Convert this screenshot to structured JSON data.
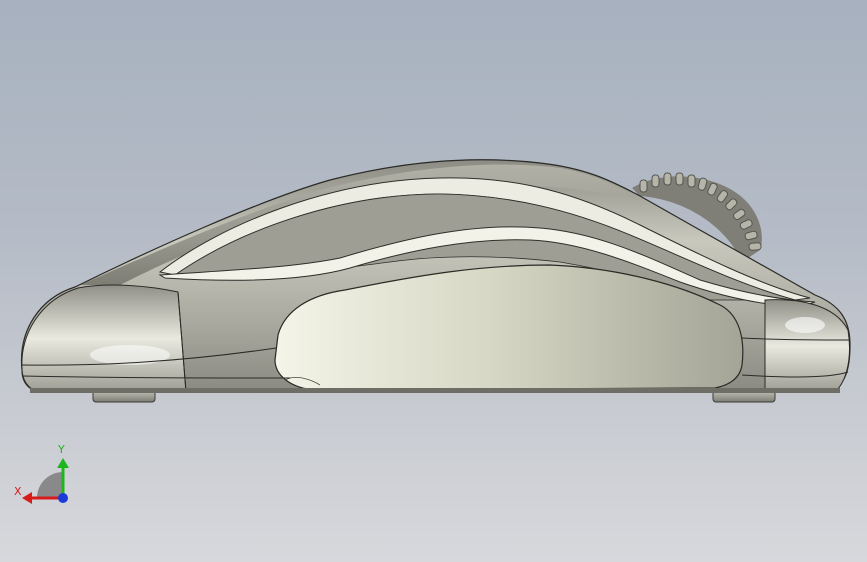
{
  "viewport": {
    "background_top": "#a7b1bf",
    "background_bottom": "#d7d8dc"
  },
  "model": {
    "view": "side",
    "body_color": "#d9d9cf",
    "edge_color": "#2a2a26"
  },
  "triad": {
    "x_label": "X",
    "y_label": "Y",
    "x_color": "#d81c1c",
    "y_color": "#1fb51f",
    "z_color": "#1c3ad8"
  }
}
